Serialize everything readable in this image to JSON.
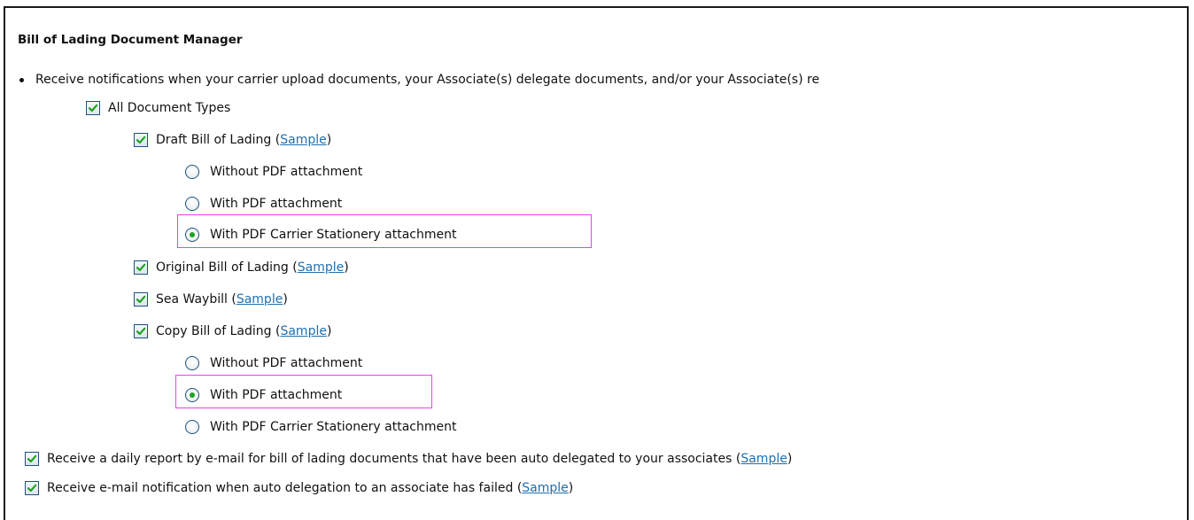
{
  "section": {
    "title": "Bill of Lading Document Manager"
  },
  "notification": {
    "bullet_text": "Receive notifications when your carrier upload documents, your Associate(s) delegate documents, and/or your Associate(s) re"
  },
  "all_types": {
    "label": "All Document Types",
    "checked": true
  },
  "draft_bl": {
    "label": "Draft Bill of Lading",
    "sample_label": "Sample",
    "checked": true,
    "options": [
      {
        "label": "Without PDF attachment",
        "selected": false
      },
      {
        "label": "With PDF attachment",
        "selected": false
      },
      {
        "label": "With PDF Carrier Stationery attachment",
        "selected": true
      }
    ]
  },
  "original_bl": {
    "label": "Original Bill of Lading",
    "sample_label": "Sample",
    "checked": true
  },
  "sea_waybill": {
    "label": "Sea Waybill",
    "sample_label": "Sample",
    "checked": true
  },
  "copy_bl": {
    "label": "Copy Bill of Lading",
    "sample_label": "Sample",
    "checked": true,
    "options": [
      {
        "label": "Without PDF attachment",
        "selected": false
      },
      {
        "label": "With PDF attachment",
        "selected": true
      },
      {
        "label": "With PDF Carrier Stationery attachment",
        "selected": false
      }
    ]
  },
  "daily_report": {
    "label": "Receive a daily report by e-mail for bill of lading documents that have been auto delegated to your associates",
    "sample_label": "Sample",
    "checked": true
  },
  "delegation_failed": {
    "label": "Receive e-mail notification when auto delegation to an associate has failed",
    "sample_label": "Sample",
    "checked": true
  },
  "colors": {
    "link": "#1f6fb0",
    "highlight": "#ee3ee6",
    "radio_dot": "#21a121",
    "checkmark": "#21a121"
  },
  "icons": {
    "checkbox": "checkbox-checked-icon",
    "radio_selected": "radio-selected-icon",
    "radio_unselected": "radio-unselected-icon"
  }
}
